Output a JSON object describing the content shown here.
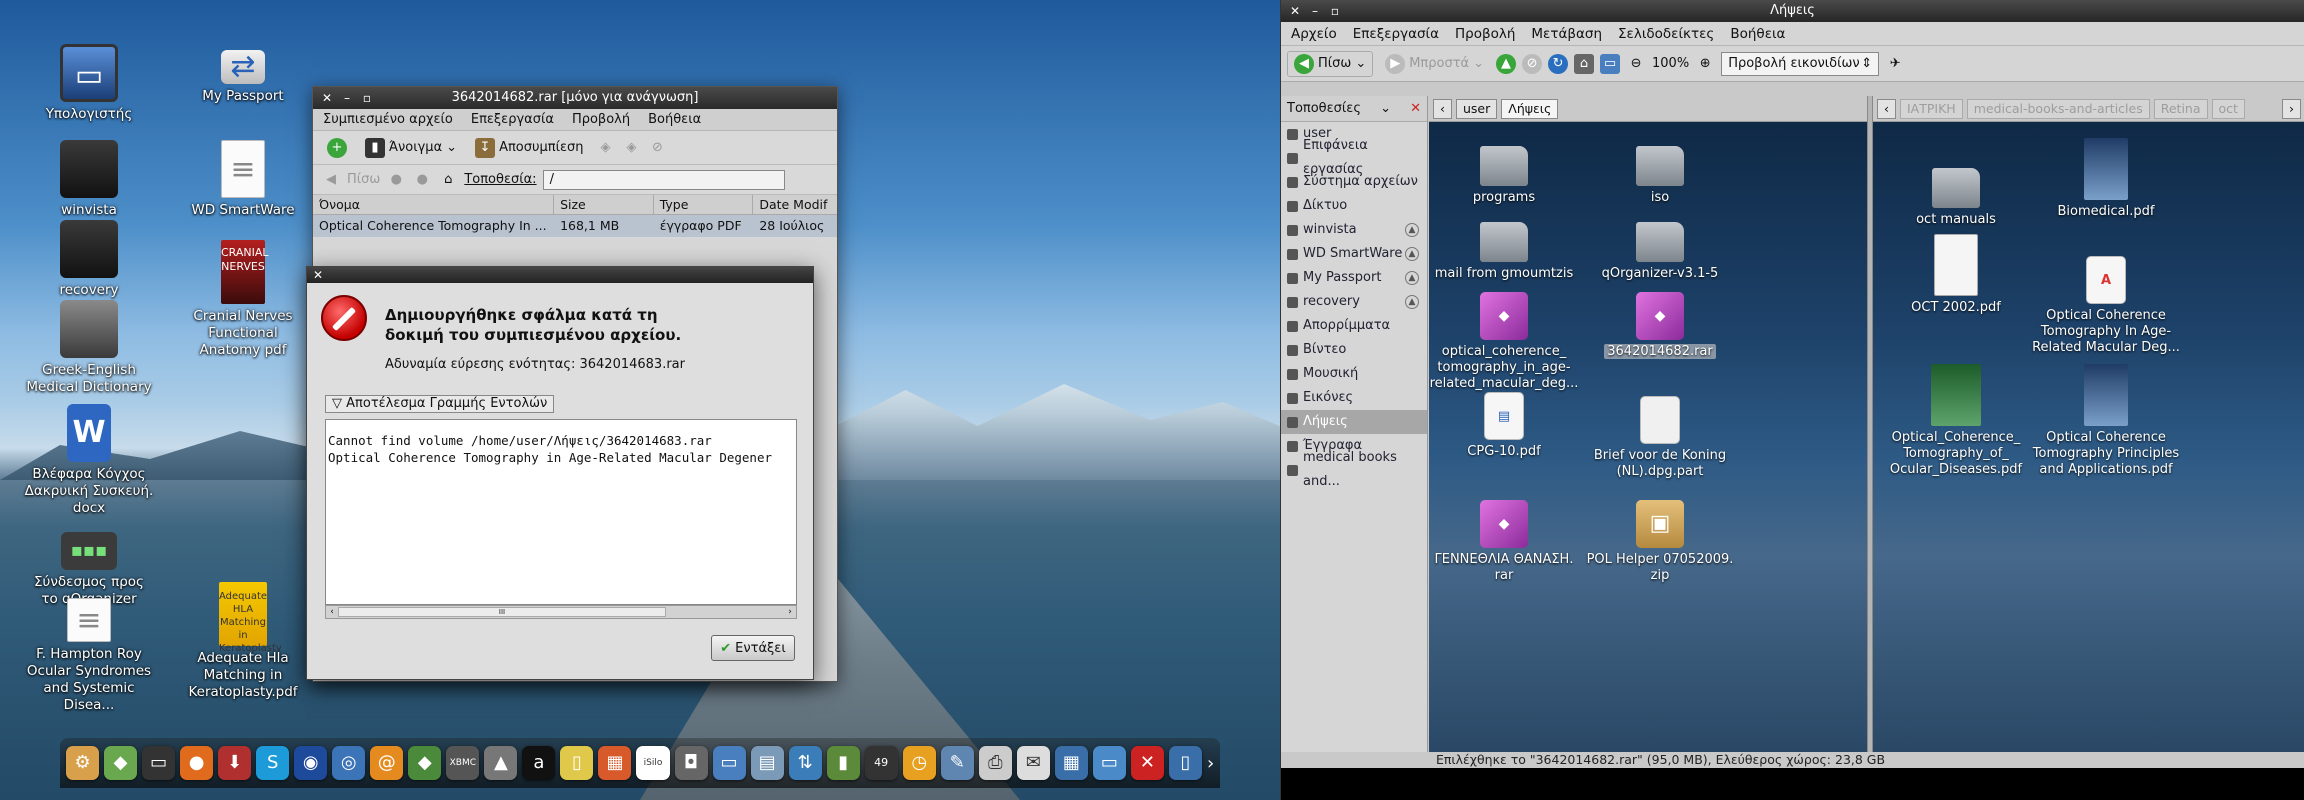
{
  "desktop_left": {
    "icons": [
      {
        "label": "Υπολογιστής",
        "icon": "computer-icon"
      },
      {
        "label": "My Passport",
        "icon": "usb-drive-icon"
      },
      {
        "label": "winvista",
        "icon": "hard-drive-icon"
      },
      {
        "label": "WD SmartWare",
        "icon": "document-icon"
      },
      {
        "label": "recovery",
        "icon": "hard-drive-icon"
      },
      {
        "label": "Cranial Nerves Functional Anatomy pdf",
        "icon": "pdf-cover-icon"
      },
      {
        "label": "Greek-English Medical Dictionary",
        "icon": "printer-drive-icon"
      },
      {
        "label": "Βλέφαρα Κόγχος Δακρυική Συσκευή. docx",
        "icon": "word-document-icon"
      },
      {
        "label": "Σύνδεσμος προς το qOrganizer",
        "icon": "link-icon"
      },
      {
        "label": "F. Hampton Roy Ocular Syndromes and Systemic Disea...",
        "icon": "document-icon"
      },
      {
        "label": "Adequate Hla Matching in Keratoplasty.pdf",
        "icon": "pdf-cover-icon"
      }
    ],
    "cover_texts": {
      "cranial": "CRANIAL NERVES",
      "adequate": "Adequate HLA Matching in Keratoplasty"
    }
  },
  "archive_window": {
    "title": "3642014682.rar [μόνο για ανάγνωση]",
    "menu": [
      "Συμπιεσμένο αρχείο",
      "Επεξεργασία",
      "Προβολή",
      "Βοήθεια"
    ],
    "toolbar": {
      "open_label": "Άνοιγμα",
      "extract_label": "Αποσυμπίεση"
    },
    "nav": {
      "back_label": "Πίσω",
      "location_label": "Τοποθεσία:",
      "location_value": "/"
    },
    "columns": [
      "Όνομα",
      "Size",
      "Type",
      "Date Modif"
    ],
    "rows": [
      {
        "name": "Optical Coherence Tomography In ...",
        "size": "168,1 MB",
        "type": "έγγραφο PDF",
        "date": "28 Ιούλιος"
      }
    ]
  },
  "error_dialog": {
    "heading": "Δημιουργήθηκε σφάλμα κατά τη δοκιμή του συμπιεσμένου αρχείου.",
    "detail": "Αδυναμία εύρεσης ενότητας: 3642014683.rar",
    "expander_label": "Αποτέλεσμα Γραμμής Εντολών",
    "output_lines": [
      "Cannot find volume /home/user/Λήψεις/3642014683.rar",
      "Optical Coherence Tomography in Age-Related Macular Degener"
    ],
    "ok_label": "Εντάξει",
    "scroll_mark": "III"
  },
  "dock": {
    "badge": "49",
    "isilo_label": "iSilo",
    "xbmc_label": "XBMC"
  },
  "file_manager": {
    "title": "Λήψεις",
    "menu": [
      "Αρχείο",
      "Επεξεργασία",
      "Προβολή",
      "Μετάβαση",
      "Σελιδοδείκτες",
      "Βοήθεια"
    ],
    "toolbar": {
      "back_label": "Πίσω",
      "forward_label": "Μπροστά",
      "zoom": "100%",
      "view_mode": "Προβολή εικονιδίων"
    },
    "sidebar": {
      "header": "Τοποθεσίες",
      "items": [
        {
          "label": "user",
          "eject": false,
          "selected": false
        },
        {
          "label": "Επιφάνεια εργασίας",
          "eject": false,
          "selected": false
        },
        {
          "label": "Σύστημα αρχείων",
          "eject": false,
          "selected": false
        },
        {
          "label": "Δίκτυο",
          "eject": false,
          "selected": false
        },
        {
          "label": "winvista",
          "eject": true,
          "selected": false
        },
        {
          "label": "WD SmartWare",
          "eject": true,
          "selected": false
        },
        {
          "label": "My Passport",
          "eject": true,
          "selected": false
        },
        {
          "label": "recovery",
          "eject": true,
          "selected": false
        },
        {
          "label": "Απορρίμματα",
          "eject": false,
          "selected": false
        },
        {
          "label": "Βίντεο",
          "eject": false,
          "selected": false
        },
        {
          "label": "Μουσική",
          "eject": false,
          "selected": false
        },
        {
          "label": "Εικόνες",
          "eject": false,
          "selected": false
        },
        {
          "label": "Λήψεις",
          "eject": false,
          "selected": true
        },
        {
          "label": "Έγγραφα",
          "eject": false,
          "selected": false
        },
        {
          "label": "medical books and...",
          "eject": false,
          "selected": false
        }
      ]
    },
    "left_pane": {
      "crumbs": [
        "user",
        "Λήψεις"
      ],
      "files": [
        {
          "label": "programs",
          "kind": "folder"
        },
        {
          "label": "iso",
          "kind": "folder"
        },
        {
          "label": "mail from gmoumtzis",
          "kind": "folder"
        },
        {
          "label": "qOrganizer-v3.1-5",
          "kind": "folder"
        },
        {
          "label": "optical_coherence_ tomography_in_age- related_macular_deg...",
          "kind": "rar"
        },
        {
          "label": "3642014682.rar",
          "kind": "rar",
          "selected": true
        },
        {
          "label": "CPG-10.pdf",
          "kind": "pdf-thumb"
        },
        {
          "label": "Brief voor de Koning (NL).dpg.part",
          "kind": "part"
        },
        {
          "label": "ΓΕΝΝΕΘΛΙΑ ΘΑΝΑΣΗ. rar",
          "kind": "rar"
        },
        {
          "label": "POL Helper 07052009. zip",
          "kind": "zip"
        }
      ]
    },
    "right_pane": {
      "crumbs": [
        "ΙΑΤΡΙΚΗ",
        "medical-books-and-articles",
        "Retina",
        "oct"
      ],
      "files": [
        {
          "label": "oct manuals",
          "kind": "folder"
        },
        {
          "label": "Biomedical.pdf",
          "kind": "pdf-thumb-blue"
        },
        {
          "label": "OCT 2002.pdf",
          "kind": "pdf-thumb-white"
        },
        {
          "label": "Optical Coherence Tomography In Age- Related Macular Deg...",
          "kind": "pdf"
        },
        {
          "label": "Optical_Coherence_ Tomography_of_ Ocular_Diseases.pdf",
          "kind": "pdf-thumb-green"
        },
        {
          "label": "Optical Coherence Tomography Principles and Applications.pdf",
          "kind": "pdf-thumb-blue"
        }
      ]
    },
    "status": "Επιλέχθηκε το \"3642014682.rar\" (95,0 MB), Ελεύθερος χώρος: 23,8 GB"
  },
  "colors": {
    "error_red": "#c40000",
    "selection": "#8896a6",
    "ok_green": "#2e9b2e"
  }
}
